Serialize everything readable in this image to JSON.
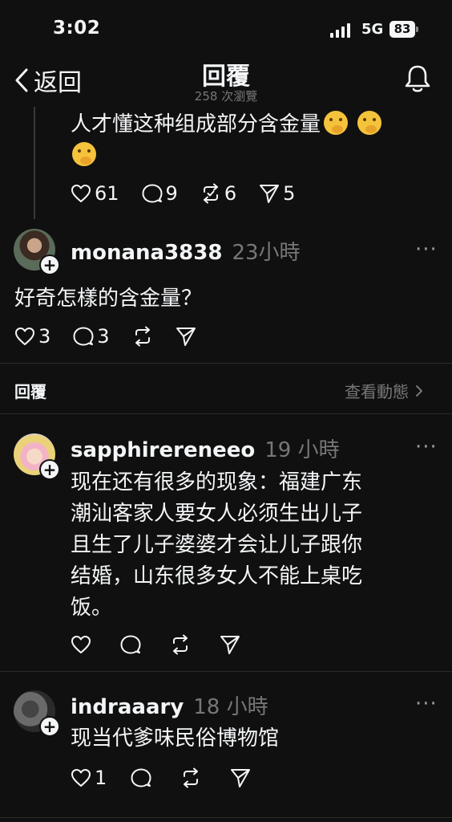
{
  "status_bar": {
    "time": "3:02",
    "network": "5G",
    "battery": "83"
  },
  "nav": {
    "back_label": "返回",
    "title": "回覆",
    "views": "258 次瀏覽"
  },
  "parent_post": {
    "text": "人才懂这种组成部分含金量",
    "stats": {
      "likes": "61",
      "comments": "9",
      "reposts": "6",
      "shares": "5"
    }
  },
  "main_post": {
    "username": "monana3838",
    "time": "23小時",
    "text": "好奇怎樣的含金量？",
    "stats": {
      "likes": "3",
      "comments": "3"
    }
  },
  "replies_header": {
    "label": "回覆",
    "activity_link": "查看動態"
  },
  "replies": [
    {
      "username": "sapphirereneeo",
      "time": "19 小時",
      "lines": [
        "现在还有很多的现象：福建广东",
        "潮汕客家人要女人必须生出儿子",
        "且生了儿子婆婆才会让儿子跟你",
        "结婚，山东很多女人不能上桌吃",
        "饭。"
      ]
    },
    {
      "username": "indraaary",
      "time": "18 小時",
      "text": "现当代爹味民俗博物馆",
      "stats": {
        "likes": "1"
      }
    }
  ],
  "more_label": "···"
}
